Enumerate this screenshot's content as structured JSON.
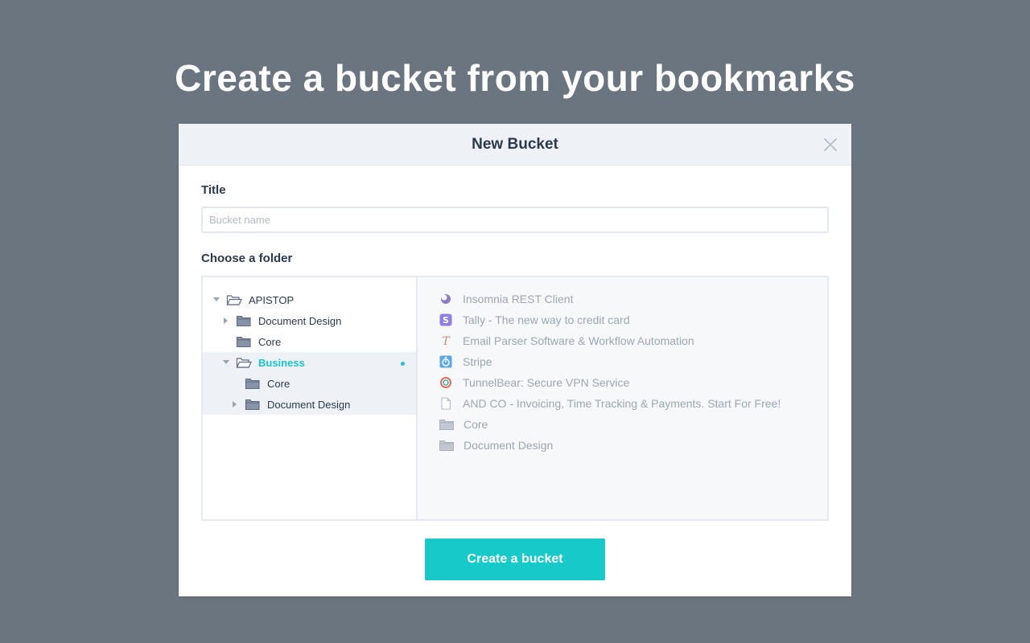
{
  "headline": "Create a bucket from your bookmarks",
  "modal": {
    "title": "New Bucket",
    "title_label": "Title",
    "title_placeholder": "Bucket name",
    "title_value": "",
    "folder_label": "Choose a folder",
    "create_button": "Create a bucket"
  },
  "tree": [
    {
      "label": "APISTOP",
      "level": 0,
      "expanded": true,
      "has_children": true,
      "open_folder": true
    },
    {
      "label": "Document Design",
      "level": 1,
      "expanded": false,
      "has_children": true
    },
    {
      "label": "Core",
      "level": 1,
      "expanded": false,
      "has_children": false
    },
    {
      "label": "Business",
      "level": 1,
      "expanded": true,
      "has_children": true,
      "open_folder": true,
      "active": true
    },
    {
      "label": "Core",
      "level": 2,
      "expanded": false,
      "has_children": false
    },
    {
      "label": "Document Design",
      "level": 2,
      "expanded": false,
      "has_children": true
    }
  ],
  "contents": [
    {
      "label": "Insomnia REST Client",
      "icon": "insomnia-icon",
      "color": "#8e7cc3"
    },
    {
      "label": "Tally - The new way to credit card",
      "icon": "tally-icon",
      "color": "#8f7ee6"
    },
    {
      "label": "Email Parser Software & Workflow Automation",
      "icon": "email-parser-icon",
      "color": "#c0926a"
    },
    {
      "label": "Stripe",
      "icon": "stripe-icon",
      "color": "#5aa7ea"
    },
    {
      "label": "TunnelBear: Secure VPN Service",
      "icon": "tunnelbear-icon",
      "color": "#e46b5d"
    },
    {
      "label": "AND CO - Invoicing, Time Tracking & Payments. Start For Free!",
      "icon": "document-icon",
      "color": "#b6bcc6"
    },
    {
      "label": "Core",
      "icon": "folder-icon",
      "color": "#c3c8d0"
    },
    {
      "label": "Document Design",
      "icon": "folder-icon",
      "color": "#c3c8d0"
    }
  ],
  "colors": {
    "background": "#6b7580",
    "accent": "#17c9c9",
    "header": "#eef1f5"
  }
}
